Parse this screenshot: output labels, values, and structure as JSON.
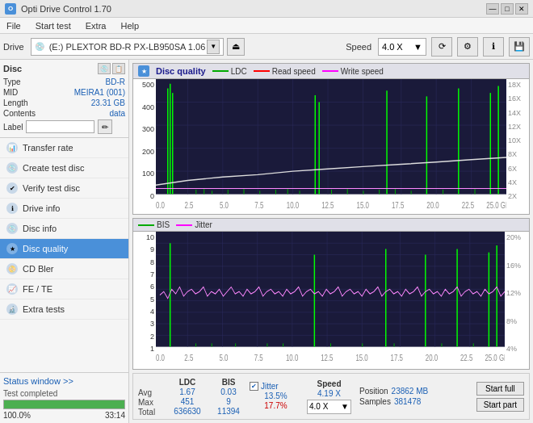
{
  "titlebar": {
    "title": "Opti Drive Control 1.70",
    "icon": "O",
    "minimize": "—",
    "maximize": "□",
    "close": "✕"
  },
  "menubar": {
    "items": [
      "File",
      "Start test",
      "Extra",
      "Help"
    ]
  },
  "toolbar": {
    "drive_label": "Drive",
    "drive_text": "(E:)  PLEXTOR BD-R  PX-LB950SA 1.06",
    "speed_label": "Speed",
    "speed_value": "4.0 X"
  },
  "disc": {
    "title": "Disc",
    "type_label": "Type",
    "type_val": "BD-R",
    "mid_label": "MID",
    "mid_val": "MEIRA1 (001)",
    "length_label": "Length",
    "length_val": "23.31 GB",
    "contents_label": "Contents",
    "contents_val": "data",
    "label_label": "Label",
    "label_val": ""
  },
  "nav": {
    "items": [
      {
        "id": "transfer-rate",
        "label": "Transfer rate",
        "active": false
      },
      {
        "id": "create-test-disc",
        "label": "Create test disc",
        "active": false
      },
      {
        "id": "verify-test-disc",
        "label": "Verify test disc",
        "active": false
      },
      {
        "id": "drive-info",
        "label": "Drive info",
        "active": false
      },
      {
        "id": "disc-info",
        "label": "Disc info",
        "active": false
      },
      {
        "id": "disc-quality",
        "label": "Disc quality",
        "active": true
      },
      {
        "id": "cd-bler",
        "label": "CD Bler",
        "active": false
      },
      {
        "id": "fe-te",
        "label": "FE / TE",
        "active": false
      },
      {
        "id": "extra-tests",
        "label": "Extra tests",
        "active": false
      }
    ]
  },
  "status": {
    "window_label": "Status window >>",
    "status_text": "Test completed",
    "progress": 100,
    "progress_pct": "100.0%",
    "time": "33:14"
  },
  "chart1": {
    "title": "Disc quality",
    "legend": [
      {
        "color": "#00aa00",
        "label": "LDC"
      },
      {
        "color": "#ff0000",
        "label": "Read speed"
      },
      {
        "color": "#ff00ff",
        "label": "Write speed"
      }
    ],
    "y_max": 500,
    "y_labels": [
      "500",
      "400",
      "300",
      "200",
      "100",
      "0"
    ],
    "y2_labels": [
      "18X",
      "16X",
      "14X",
      "12X",
      "10X",
      "8X",
      "6X",
      "4X",
      "2X"
    ],
    "x_labels": [
      "0.0",
      "2.5",
      "5.0",
      "7.5",
      "10.0",
      "12.5",
      "15.0",
      "17.5",
      "20.0",
      "22.5",
      "25.0 GB"
    ]
  },
  "chart2": {
    "legend": [
      {
        "color": "#00aa00",
        "label": "BIS"
      },
      {
        "color": "#ff00ff",
        "label": "Jitter"
      }
    ],
    "y_max": 10,
    "y_labels": [
      "10",
      "9",
      "8",
      "7",
      "6",
      "5",
      "4",
      "3",
      "2",
      "1"
    ],
    "y2_labels": [
      "20%",
      "16%",
      "12%",
      "8%",
      "4%"
    ],
    "x_labels": [
      "0.0",
      "2.5",
      "5.0",
      "7.5",
      "10.0",
      "12.5",
      "15.0",
      "17.5",
      "20.0",
      "22.5",
      "25.0 GB"
    ]
  },
  "stats": {
    "ldc_header": "LDC",
    "bis_header": "BIS",
    "jitter_header": "Jitter",
    "jitter_checked": true,
    "speed_header": "Speed",
    "speed_val": "4.19 X",
    "speed_select": "4.0 X",
    "avg_label": "Avg",
    "avg_ldc": "1.67",
    "avg_bis": "0.03",
    "avg_jitter": "13.5%",
    "max_label": "Max",
    "max_ldc": "451",
    "max_bis": "9",
    "max_jitter": "17.7%",
    "total_label": "Total",
    "total_ldc": "636630",
    "total_bis": "11394",
    "position_label": "Position",
    "position_val": "23862 MB",
    "samples_label": "Samples",
    "samples_val": "381478",
    "start_full_label": "Start full",
    "start_part_label": "Start part"
  }
}
